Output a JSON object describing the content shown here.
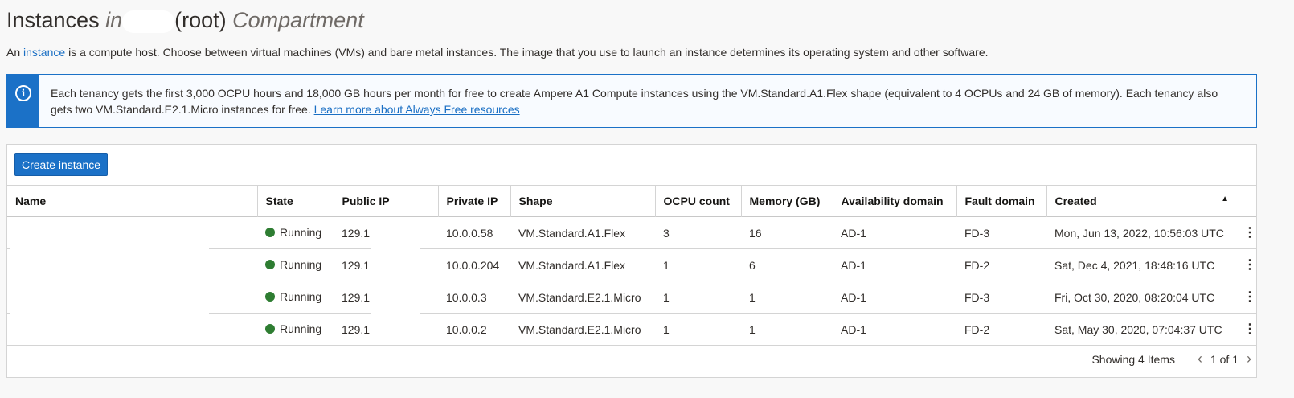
{
  "header": {
    "title_main": "Instances",
    "title_in": "in",
    "title_root": "(root)",
    "title_compartment": "Compartment"
  },
  "description": {
    "prefix": "An",
    "link": "instance",
    "rest": "is a compute host. Choose between virtual machines (VMs) and bare metal instances. The image that you use to launch an instance determines its operating system and other software."
  },
  "info": {
    "text": "Each tenancy gets the first 3,000 OCPU hours and 18,000 GB hours per month for free to create Ampere A1 Compute instances using the VM.Standard.A1.Flex shape (equivalent to 4 OCPUs and 24 GB of memory). Each tenancy also gets two VM.Standard.E2.1.Micro instances for free.",
    "link": "Learn more about Always Free resources"
  },
  "toolbar": {
    "create_label": "Create instance"
  },
  "table": {
    "columns": [
      "Name",
      "State",
      "Public IP",
      "Private IP",
      "Shape",
      "OCPU count",
      "Memory (GB)",
      "Availability domain",
      "Fault domain",
      "Created"
    ],
    "rows": [
      {
        "name": "",
        "state": "Running",
        "public_ip": "129.1",
        "private_ip": "10.0.0.58",
        "shape": "VM.Standard.A1.Flex",
        "ocpu": "3",
        "memory": "16",
        "ad": "AD-1",
        "fd": "FD-3",
        "created": "Mon, Jun 13, 2022, 10:56:03 UTC"
      },
      {
        "name": "",
        "state": "Running",
        "public_ip": "129.1",
        "private_ip": "10.0.0.204",
        "shape": "VM.Standard.A1.Flex",
        "ocpu": "1",
        "memory": "6",
        "ad": "AD-1",
        "fd": "FD-2",
        "created": "Sat, Dec 4, 2021, 18:48:16 UTC"
      },
      {
        "name": "",
        "state": "Running",
        "public_ip": "129.1",
        "private_ip": "10.0.0.3",
        "shape": "VM.Standard.E2.1.Micro",
        "ocpu": "1",
        "memory": "1",
        "ad": "AD-1",
        "fd": "FD-3",
        "created": "Fri, Oct 30, 2020, 08:20:04 UTC"
      },
      {
        "name": "",
        "state": "Running",
        "public_ip": "129.1",
        "private_ip": "10.0.0.2",
        "shape": "VM.Standard.E2.1.Micro",
        "ocpu": "1",
        "memory": "1",
        "ad": "AD-1",
        "fd": "FD-2",
        "created": "Sat, May 30, 2020, 07:04:37 UTC"
      }
    ]
  },
  "footer": {
    "showing": "Showing 4 Items",
    "page": "1 of 1",
    "prev_icon": "chevron-left-icon",
    "next_icon": "chevron-right-icon"
  },
  "colors": {
    "accent": "#1b71c7",
    "running": "#2e7d32"
  }
}
